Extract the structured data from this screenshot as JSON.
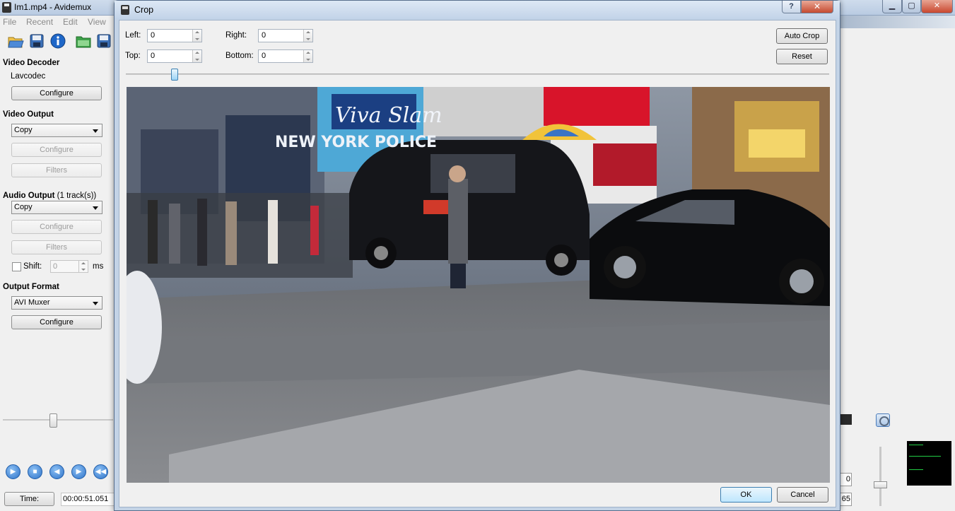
{
  "main_window": {
    "title": "Im1.mp4 - Avidemux",
    "menu": [
      "File",
      "Recent",
      "Edit",
      "View"
    ],
    "toolbar_icons": [
      "open-file-icon",
      "save-file-icon",
      "info-icon",
      "open-folder-icon",
      "save-as-icon"
    ],
    "video_decoder": {
      "heading": "Video Decoder",
      "codec": "Lavcodec",
      "configure_label": "Configure"
    },
    "video_output": {
      "heading": "Video Output",
      "selected": "Copy",
      "configure_label": "Configure",
      "filters_label": "Filters"
    },
    "audio_output": {
      "heading": "Audio Output",
      "tracks": "(1 track(s))",
      "selected": "Copy",
      "configure_label": "Configure",
      "filters_label": "Filters",
      "shift_label": "Shift:",
      "shift_value": "0",
      "shift_unit": "ms",
      "shift_checked": false
    },
    "output_format": {
      "heading": "Output Format",
      "selected": "AVI Muxer",
      "configure_label": "Configure"
    },
    "time_label": "Time:",
    "time_value": "00:00:51.051",
    "right_partial_values": [
      "0",
      "65"
    ]
  },
  "crop_dialog": {
    "title": "Crop",
    "help_glyph": "?",
    "close_glyph": "✕",
    "left_label": "Left:",
    "left_value": "0",
    "right_label": "Right:",
    "right_value": "0",
    "top_label": "Top:",
    "top_value": "0",
    "bottom_label": "Bottom:",
    "bottom_value": "0",
    "auto_crop_label": "Auto Crop",
    "reset_label": "Reset",
    "ok_label": "OK",
    "cancel_label": "Cancel",
    "preview_signs": [
      "Viva Slam",
      "NEW YORK POLICE"
    ]
  },
  "colors": {
    "titlebar": "#c2d3e8",
    "close_red": "#c54a30",
    "accent_blue": "#2e73c9"
  }
}
